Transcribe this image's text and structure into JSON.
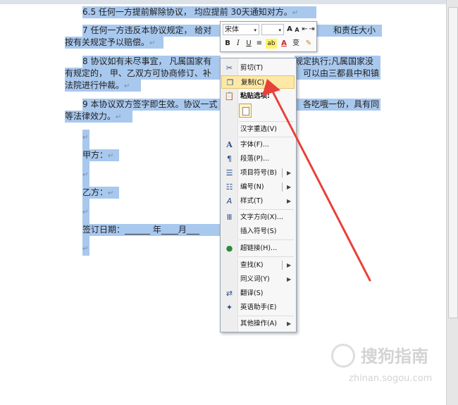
{
  "document": {
    "lines": [
      {
        "text": "6.5 任何一方提前解除协议，  均应提前 30天通知对方。",
        "mark": "↵"
      },
      {
        "text": "7 任何一方违反本协议规定，  给对",
        "mark": ""
      },
      {
        "text": "和责任大小",
        "mark": ""
      },
      {
        "text": "按有关规定予以赔偿。",
        "mark": "↵"
      },
      {
        "text": "8 协议如有未尽事宜，  凡属国家有",
        "mark": ""
      },
      {
        "text": "规定执行;凡属国家没",
        "mark": ""
      },
      {
        "text": "有规定的，  甲、乙双方可协商修订、补",
        "mark": ""
      },
      {
        "text": "可以由三都县中和镇",
        "mark": ""
      },
      {
        "text": "法院进行仲裁。",
        "mark": "↵"
      },
      {
        "text": "9 本协议双方签字即生效。协议一式",
        "mark": ""
      },
      {
        "text": "各吃哦一份，具有同",
        "mark": ""
      },
      {
        "text": "等法律效力。",
        "mark": "↵"
      },
      {
        "text": "",
        "mark": "↵"
      },
      {
        "text": "甲方：",
        "mark": "↵"
      },
      {
        "text": "",
        "mark": "↵"
      },
      {
        "text": "乙方：",
        "mark": "↵"
      },
      {
        "text": "",
        "mark": "↵"
      },
      {
        "text": "签订日期：______ 年____月___",
        "mark": ""
      },
      {
        "text": "",
        "mark": "↵"
      }
    ]
  },
  "mini_toolbar": {
    "font_name": "宋体",
    "font_size": "",
    "grow_font": "A",
    "shrink_font": "A",
    "bold": "B",
    "italic": "I",
    "underline": "U",
    "align": "≡",
    "highlight": "ab",
    "font_color": "A",
    "phonetic": "变"
  },
  "context_menu": {
    "items": [
      {
        "label": "剪切(T)",
        "icon": "scissors-icon",
        "glyph": "✂"
      },
      {
        "label": "复制(C)",
        "icon": "copy-icon",
        "glyph": "❐"
      },
      {
        "label": "粘贴选项:",
        "icon": "paste-icon",
        "glyph": "📋"
      },
      {
        "label": "汉字重选(V)",
        "icon": "",
        "glyph": ""
      },
      {
        "label": "字体(F)...",
        "icon": "font-icon",
        "glyph": "A"
      },
      {
        "label": "段落(P)...",
        "icon": "paragraph-icon",
        "glyph": "¶"
      },
      {
        "label": "项目符号(B)",
        "icon": "bullets-icon",
        "glyph": "☰"
      },
      {
        "label": "编号(N)",
        "icon": "numbering-icon",
        "glyph": "☷"
      },
      {
        "label": "样式(T)",
        "icon": "styles-icon",
        "glyph": "A"
      },
      {
        "label": "文字方向(X)...",
        "icon": "text-direction-icon",
        "glyph": "Ⅲ"
      },
      {
        "label": "插入符号(S)",
        "icon": "",
        "glyph": ""
      },
      {
        "label": "超链接(H)...",
        "icon": "hyperlink-icon",
        "glyph": "🌐"
      },
      {
        "label": "查找(K)",
        "icon": "",
        "glyph": ""
      },
      {
        "label": "同义词(Y)",
        "icon": "",
        "glyph": ""
      },
      {
        "label": "翻译(S)",
        "icon": "translate-icon",
        "glyph": "⇄"
      },
      {
        "label": "英语助手(E)",
        "icon": "english-assistant-icon",
        "glyph": "✦"
      },
      {
        "label": "其他操作(A)",
        "icon": "",
        "glyph": ""
      }
    ]
  },
  "watermark": {
    "brand": "搜狗指南",
    "url": "zhinan.sogou.com"
  },
  "colors": {
    "selection": "#a8c8ee",
    "highlight": "#fde8a8",
    "arrow": "#e8413a"
  }
}
